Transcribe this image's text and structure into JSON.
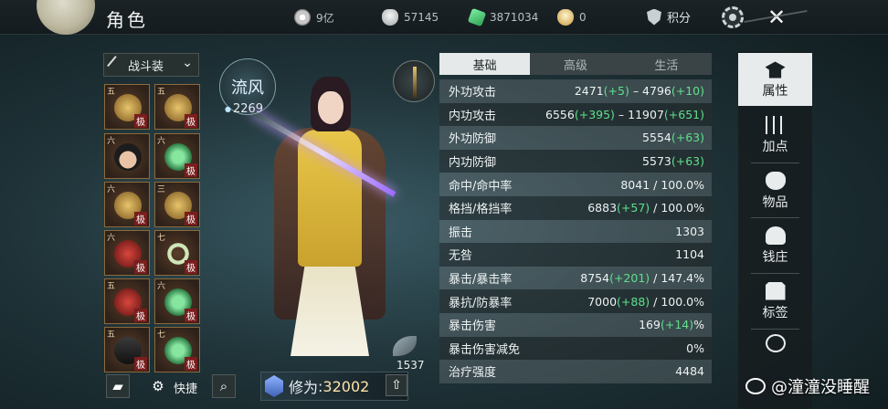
{
  "header": {
    "title": "角色",
    "currencies": [
      {
        "icon": "coin-icon",
        "value": "9亿"
      },
      {
        "icon": "silver-icon",
        "value": "57145"
      },
      {
        "icon": "jade-icon",
        "value": "3871034"
      },
      {
        "icon": "gold-ingot-icon",
        "value": "0"
      }
    ],
    "points_label": "积分",
    "close_glyph": "✕"
  },
  "equipment": {
    "set_selector": "战斗装",
    "slots": [
      {
        "tier": "五",
        "grade": "极"
      },
      {
        "tier": "五",
        "grade": "极"
      },
      {
        "tier": "六",
        "grade": ""
      },
      {
        "tier": "六",
        "grade": "极"
      },
      {
        "tier": "六",
        "grade": "极"
      },
      {
        "tier": "三",
        "grade": "极"
      },
      {
        "tier": "六",
        "grade": "极"
      },
      {
        "tier": "七",
        "grade": "极"
      },
      {
        "tier": "五",
        "grade": "极"
      },
      {
        "tier": "六",
        "grade": "极"
      },
      {
        "tier": "五",
        "grade": "极"
      },
      {
        "tier": "七",
        "grade": "极"
      }
    ]
  },
  "character": {
    "badge_text": "流风",
    "power": "2269",
    "cultivation_label": "修为",
    "cultivation_value": "32002",
    "quick_label": "快捷",
    "feather_count": "1537"
  },
  "stats": {
    "tabs": [
      "基础",
      "高级",
      "生活"
    ],
    "active_tab": "基础",
    "rows": [
      {
        "name": "外功攻击",
        "parts": [
          "2471",
          "(+5)",
          " – 4796",
          "(+10)"
        ]
      },
      {
        "name": "内功攻击",
        "parts": [
          "6556",
          "(+395)",
          " – 11907",
          "(+651)"
        ]
      },
      {
        "name": "外功防御",
        "parts": [
          "5554",
          "(+63)",
          "",
          ""
        ]
      },
      {
        "name": "内功防御",
        "parts": [
          "5573",
          "(+63)",
          "",
          ""
        ]
      },
      {
        "name": "命中/命中率",
        "parts": [
          "8041 / 100.0%",
          "",
          "",
          ""
        ]
      },
      {
        "name": "格挡/格挡率",
        "parts": [
          "6883",
          "(+57)",
          " / 100.0%",
          ""
        ]
      },
      {
        "name": "振击",
        "parts": [
          "1303",
          "",
          "",
          ""
        ]
      },
      {
        "name": "无咎",
        "parts": [
          "1104",
          "",
          "",
          ""
        ]
      },
      {
        "name": "暴击/暴击率",
        "parts": [
          "8754",
          "(+201)",
          " / 147.4%",
          ""
        ]
      },
      {
        "name": "暴抗/防暴率",
        "parts": [
          "7000",
          "(+88)",
          " / 100.0%",
          ""
        ]
      },
      {
        "name": "暴击伤害",
        "parts": [
          "169",
          "(+14)",
          "%",
          ""
        ]
      },
      {
        "name": "暴击伤害减免",
        "parts": [
          "0%",
          "",
          "",
          ""
        ]
      },
      {
        "name": "治疗强度",
        "parts": [
          "4484",
          "",
          "",
          ""
        ]
      }
    ]
  },
  "side_menu": {
    "items": [
      {
        "label": "属性",
        "icon": "scholar-hat-icon"
      },
      {
        "label": "加点",
        "icon": "sliders-icon"
      },
      {
        "label": "物品",
        "icon": "bag-icon"
      },
      {
        "label": "钱庄",
        "icon": "bank-icon"
      },
      {
        "label": "标签",
        "icon": "tag-icon"
      }
    ]
  },
  "watermark": "@潼潼没睡醒",
  "colors": {
    "plus": "#5fe08c",
    "accent": "#e8ebec"
  }
}
